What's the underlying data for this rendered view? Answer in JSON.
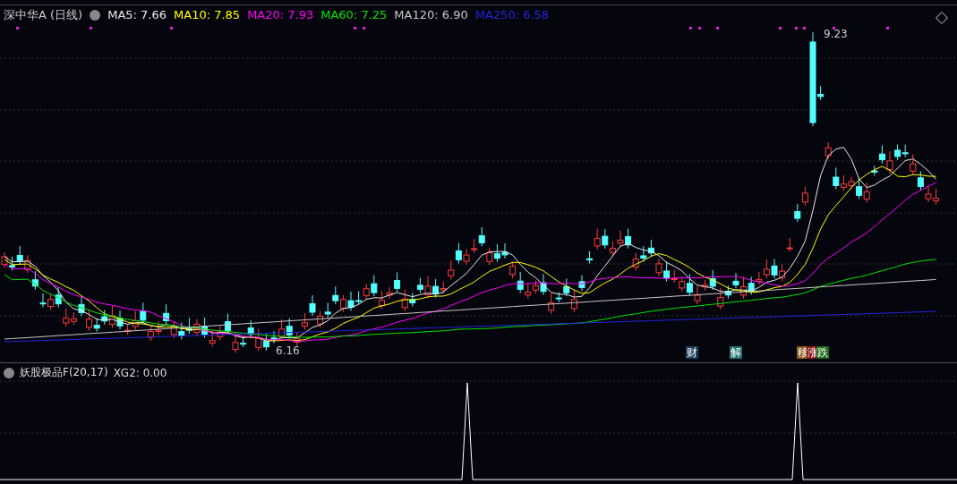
{
  "header": {
    "stock": "深中华A (日线)",
    "ma": [
      {
        "label": "MA5: 7.66",
        "color": "#e8e8e8"
      },
      {
        "label": "MA10: 7.85",
        "color": "#ffff00"
      },
      {
        "label": "MA20: 7.93",
        "color": "#ff00ff"
      },
      {
        "label": "MA60: 7.25",
        "color": "#00e600"
      },
      {
        "label": "MA120: 6.90",
        "color": "#c8c8c8"
      },
      {
        "label": "MA250: 6.58",
        "color": "#2424e0"
      }
    ]
  },
  "price_chart": {
    "high_label": "9.23",
    "low_label": "6.16",
    "markers": [
      {
        "text": "财",
        "color": "#1d3c5a"
      },
      {
        "text": "解",
        "color": "#1f6f6f"
      },
      {
        "text": "移",
        "color": "#8b5a1a"
      },
      {
        "text": "涨",
        "color": "#8b1a1a"
      },
      {
        "text": "跌",
        "color": "#1a6b1a"
      }
    ]
  },
  "indicator": {
    "title": "妖股极品F(20,17)",
    "value": "XG2: 0.00"
  }
}
